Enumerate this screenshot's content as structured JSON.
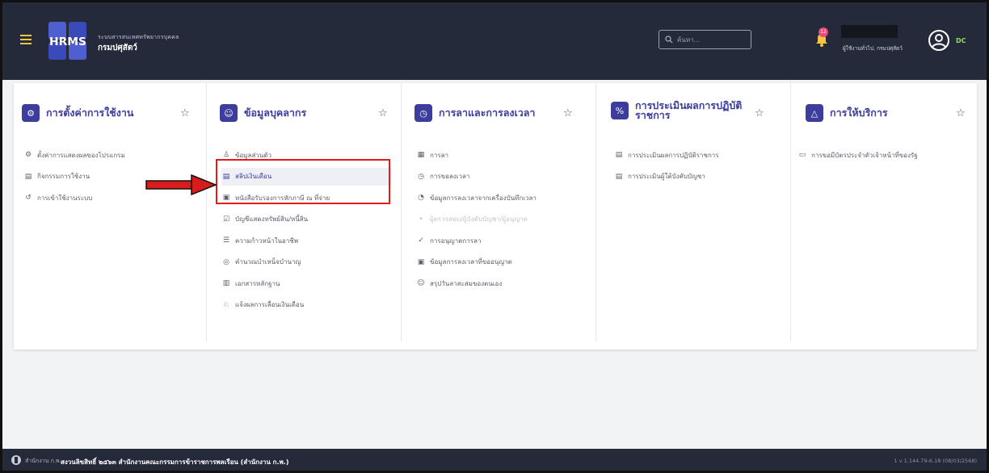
{
  "header": {
    "system_title": "ระบบสารสนเทศทรัพยากรบุคคล",
    "department": "กรมปศุสัตว์",
    "search_placeholder": "ค้นหา...",
    "notification_count": "12",
    "user_text": "ผู้ใช้งานทั่วไป, กรมปศุสัตว์",
    "avatar_initials": "DC",
    "logo_text": "HRMS"
  },
  "menu": {
    "columns": [
      {
        "icon": "gear-icon",
        "title": "การตั้งค่าการใช้งาน",
        "items": [
          {
            "icon": "gear-icon",
            "label": "ตั้งค่าการแสดงผลของโปรแกรม"
          },
          {
            "icon": "calendar-icon",
            "label": "กิจกรรมการใช้งาน"
          },
          {
            "icon": "history-icon",
            "label": "การเข้าใช้งานระบบ"
          }
        ]
      },
      {
        "icon": "users-icon",
        "title": "ข้อมูลบุคลากร",
        "items": [
          {
            "icon": "user-icon",
            "label": "ข้อมูลส่วนตัว"
          },
          {
            "icon": "payslip-icon",
            "label": "สลิปเงินเดือน"
          },
          {
            "icon": "document-icon",
            "label": "หนังสือรับรองการหักภาษี ณ ที่จ่าย"
          },
          {
            "icon": "ledger-icon",
            "label": "บัญชีแสดงทรัพย์สิน/หนี้สิน"
          },
          {
            "icon": "list-icon",
            "label": "ความก้าวหน้าในอาชีพ"
          },
          {
            "icon": "coin-icon",
            "label": "คำนวณบำเหน็จบำนาญ"
          },
          {
            "icon": "file-icon",
            "label": "เอกสารหลักฐาน"
          },
          {
            "icon": "bell-icon",
            "label": "แจ้งผลการเลื่อนเงินเดือน"
          }
        ]
      },
      {
        "icon": "clock-icon",
        "title": "การลาและการลงเวลา",
        "items": [
          {
            "icon": "leave-icon",
            "label": "การลา"
          },
          {
            "icon": "clock-icon",
            "label": "การขอลงเวลา"
          },
          {
            "icon": "time-icon",
            "label": "ข้อมูลการลงเวลาจากเครื่องบันทึกเวลา"
          },
          {
            "icon": "dot-icon",
            "label": "ผู้ตรวจสอบ/ผู้บังคับบัญชา/ผู้อนุญาต"
          },
          {
            "icon": "check-icon",
            "label": "การอนุญาตการลา"
          },
          {
            "icon": "calendar-check-icon",
            "label": "ข้อมูลการลงเวลาที่ขออนุญาต"
          },
          {
            "icon": "users-icon",
            "label": "สรุปวันลาสะสมของตนเอง"
          }
        ]
      },
      {
        "icon": "percent-icon",
        "title": "การประเมินผลการปฏิบัติราชการ",
        "items": [
          {
            "icon": "clipboard-icon",
            "label": "การประเมินผลการปฏิบัติราชการ"
          },
          {
            "icon": "clipboard-icon",
            "label": "การประเมินผู้ใต้บังคับบัญชา"
          }
        ]
      },
      {
        "icon": "triangle-icon",
        "title": "การให้บริการ",
        "items": [
          {
            "icon": "id-card-icon",
            "label": "การขอมีบัตรประจำตัวเจ้าหน้าที่ของรัฐ"
          }
        ]
      }
    ]
  },
  "footer": {
    "org": "สำนักงาน ก.พ.",
    "copyright": "สงวนลิขสิทธิ์ ๒๕๖๓ สำนักงานคณะกรรมการข้าราชการพลเรือน (สำนักงาน ก.พ.)",
    "version": "1 v 1.144.79-6.18 (08/03/2568)"
  },
  "colors": {
    "header_bg": "#252a3a",
    "accent": "#3d3d9e",
    "highlight_border": "#e31b1b",
    "arrow": "#d81c1c"
  }
}
